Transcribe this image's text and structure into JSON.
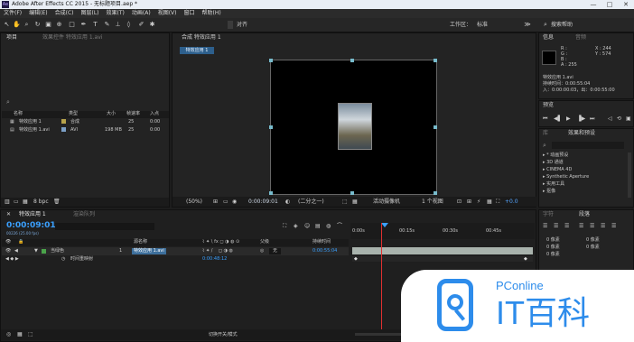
{
  "app": {
    "title": "Adobe After Effects CC 2015 - 无标题项目.aep *",
    "logo_text": "Ae",
    "window_buttons": [
      "—",
      "□",
      "✕"
    ]
  },
  "menu": [
    "文件(F)",
    "编辑(E)",
    "合成(C)",
    "图层(L)",
    "效果(T)",
    "动画(A)",
    "视图(V)",
    "窗口",
    "帮助(H)"
  ],
  "toolbar": {
    "align_label": "对齐",
    "workspace_label": "工作区：",
    "workspace_value": "标准",
    "search_placeholder": "搜索帮助"
  },
  "project_panel": {
    "tab_label": "项目",
    "effect_controls_tab": "效果控件 特效应用 1.avi",
    "search_icon": "search-icon",
    "columns": [
      "名称",
      "",
      "类型",
      "大小",
      "帧速率",
      "入点"
    ],
    "items": [
      {
        "name": "特效应用 1",
        "color": "#b7a34b",
        "type": "合成",
        "size": "",
        "fps": "25",
        "in": "0:00"
      },
      {
        "name": "特效应用 1.avi",
        "color": "#7b9fc6",
        "type": "AVI",
        "size": "198 MB",
        "fps": "25",
        "in": "0:00"
      }
    ],
    "bpc": "8 bpc"
  },
  "composition_panel": {
    "tab_label": "合成 特效应用 1",
    "sub_tab": "特效应用 1",
    "zoom": "(50%)",
    "timecode": "0:00:09:01",
    "resolution": "(二分之一)",
    "camera": "活动摄像机",
    "views": "1 个视图",
    "exposure": "+0.0"
  },
  "info_panel": {
    "tab_label": "信息",
    "audio_tab": "音频",
    "r": "R :",
    "g": "G :",
    "b": "B :",
    "a": "A : 255",
    "x": "X : 244",
    "y": "Y : 574",
    "line1": "特效应用 1.avi",
    "line2": "持续时间：0:00:55:04",
    "line3": "入：0:00:00:03，出：0:00:55:00"
  },
  "preview_panel": {
    "tab_label": "预览"
  },
  "effects_panel": {
    "tab_label": "效果和预设",
    "other_tab": "库",
    "search_icon": "search-icon",
    "items": [
      "* 动画预设",
      "3D 通道",
      "CINEMA 4D",
      "Synthetic Aperture",
      "实用工具",
      "抠像"
    ]
  },
  "timeline": {
    "tab_label": "特效应用 1",
    "render_tab": "渲染队列",
    "timecode": "0:00:09:01",
    "sub_timecode": "00226 (25.00 fps)",
    "columns": [
      "源名称",
      "模式",
      "TrkMat",
      "父级",
      "持续时间"
    ],
    "layer": {
      "index": "1",
      "name": "特效应用 1.avi",
      "parent": "无",
      "duration": "0:00:55:04",
      "label_name": "当绿色"
    },
    "sublayer": {
      "name": "时间重映射",
      "value": "0:00:48:12"
    },
    "ruler": [
      "0:00s",
      "00:15s",
      "00:30s",
      "00:45s"
    ],
    "footer": "切换开关/模式"
  },
  "paragraph_panel": {
    "tab_label": "段落",
    "char_tab": "字符",
    "values": [
      "0 像素",
      "0 像素",
      "0 像素",
      "0 像素",
      "0 像素"
    ]
  },
  "watermark": {
    "brand_top": "PConline",
    "brand_main": "IT百科"
  },
  "colors": {
    "accent_blue": "#2d8ceb",
    "timecode_blue": "#3aa0ff",
    "playhead_red": "#e03030",
    "layer_bar": "#a9b3ad"
  }
}
